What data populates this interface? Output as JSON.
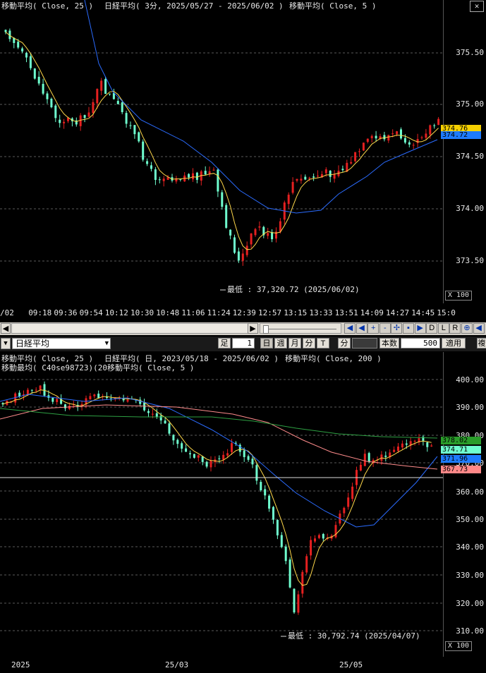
{
  "top_chart": {
    "legend": [
      "移動平均( Close, 25 )",
      "日経平均( 3分, 2025/05/27 - 2025/06/02 )",
      "移動平均( Close, 5 )"
    ],
    "y_ticks": [
      "375.50",
      "375.00",
      "374.50",
      "374.00",
      "373.50"
    ],
    "price_tags": [
      {
        "text": "374.76",
        "bg": "#f5d000",
        "fg": "#000000"
      },
      {
        "text": "374.72",
        "bg": "#1e7bff",
        "fg": "#000000"
      }
    ],
    "min_label": "最低 : 37,320.72 (2025/06/02)",
    "zoom_label": "X 100",
    "x_labels": [
      "/02",
      "09:18",
      "09:36",
      "09:54",
      "10:12",
      "10:30",
      "10:48",
      "11:06",
      "11:24",
      "12:39",
      "12:57",
      "13:15",
      "13:33",
      "13:51",
      "14:09",
      "14:27",
      "14:45",
      "15:0"
    ]
  },
  "toolbar": {
    "nav_buttons": [
      "◀",
      "◀",
      "+",
      "-",
      "✢",
      "▪",
      "▶",
      "D",
      "L",
      "R",
      "⊕",
      "◀"
    ],
    "symbol_select": "日経平均",
    "foot_label": "足",
    "foot_value": "1",
    "period_buttons": [
      "日",
      "週",
      "月",
      "分",
      "T"
    ],
    "minute_label": "分",
    "count_label": "本数",
    "count_value": "500",
    "apply_button": "適用",
    "extra_button": "複"
  },
  "bottom_chart": {
    "legend_line1": [
      "移動平均( Close, 25 )",
      "日経平均( 日, 2023/05/18 - 2025/06/02 )",
      "移動平均( Close, 200 )"
    ],
    "legend_line2": "移動最均( C40se98723)(20移動平均( Close, 5 )",
    "y_ticks": [
      "400.00",
      "390.00",
      "380.00",
      "370.00",
      "360.00",
      "350.00",
      "340.00",
      "330.00",
      "320.00",
      "310.00"
    ],
    "price_tags": [
      {
        "text": "378.02",
        "bg": "#2a9d2a",
        "fg": "#000000"
      },
      {
        "text": "374.71",
        "bg": "#6fffcf",
        "fg": "#000000"
      },
      {
        "text": "371.96",
        "bg": "#1e7bff",
        "fg": "#000000"
      },
      {
        "text": "367.73",
        "bg": "#ff8888",
        "fg": "#000000"
      }
    ],
    "min_label": "最低 : 30,792.74 (2025/04/07)",
    "zoom_label": "X 100",
    "x_labels": [
      "2025",
      "25/03",
      "25/05"
    ]
  },
  "colors": {
    "up": "#e52020",
    "down": "#6fffcf",
    "ma5": "#ffd84a",
    "ma25": "#2b6cff",
    "ma200": "#ff8c8c",
    "ma_green": "#2ea043",
    "grid": "#5a5a5a"
  }
}
